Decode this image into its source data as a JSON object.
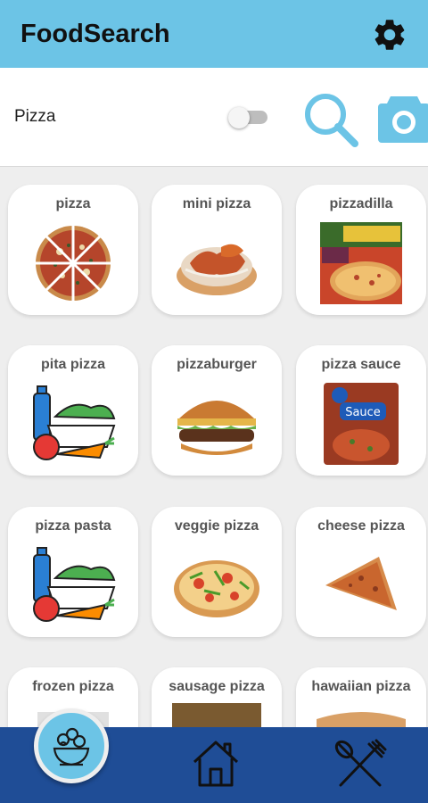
{
  "app": {
    "title": "FoodSearch"
  },
  "search": {
    "query": "Pizza",
    "toggle_on": false
  },
  "results": [
    {
      "label": "pizza",
      "image": "pizza-slices-image"
    },
    {
      "label": "mini pizza",
      "image": "mini-pizza-image"
    },
    {
      "label": "pizzadilla",
      "image": "pizzadilla-box-image"
    },
    {
      "label": "pita pizza",
      "image": "generic-food-icon"
    },
    {
      "label": "pizzaburger",
      "image": "burger-image"
    },
    {
      "label": "pizza sauce",
      "image": "sauce-packet-image"
    },
    {
      "label": "pizza pasta",
      "image": "generic-food-icon"
    },
    {
      "label": "veggie pizza",
      "image": "veggie-pizza-image"
    },
    {
      "label": "cheese pizza",
      "image": "pizza-slice-image"
    },
    {
      "label": "frozen pizza",
      "image": "frozen-pizza-image"
    },
    {
      "label": "sausage pizza",
      "image": "sausage-pizza-image"
    },
    {
      "label": "hawaiian pizza",
      "image": "hawaiian-pizza-image"
    }
  ],
  "nav": {
    "items": [
      "salad-icon",
      "home-icon",
      "utensils-icon"
    ]
  },
  "colors": {
    "appbar": "#6cc4e6",
    "bottombar": "#1f4d96",
    "accent": "#6cc4e6"
  }
}
